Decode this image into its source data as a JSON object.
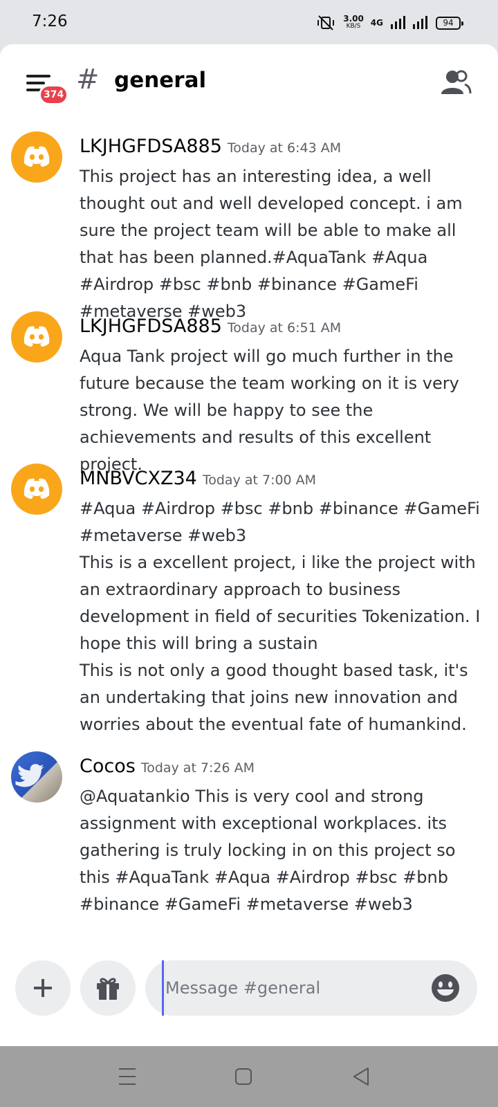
{
  "status_bar": {
    "time": "7:26",
    "speed_value": "3.00",
    "speed_unit": "KB/S",
    "network": "4G",
    "battery": "94"
  },
  "header": {
    "unread_badge": "374",
    "channel_name": "general"
  },
  "messages": [
    {
      "username": "LKJHGFDSA885",
      "timestamp": "Today at 6:43 AM",
      "avatar": "discord-logo-icon",
      "text": "This project has an interesting idea, a well thought out and well developed concept. i am sure the project team will be able to make all that has been planned.#AquaTank #Aqua #Airdrop #bsc #bnb #binance #GameFi #metaverse #web3"
    },
    {
      "username": "LKJHGFDSA885",
      "timestamp": "Today at 6:51 AM",
      "avatar": "discord-logo-icon",
      "text": "Aqua Tank project will go much further in the future because the team working on it is very strong. We will be happy to see the achievements and results of this excellent project."
    },
    {
      "username": "MNBVCXZ34",
      "timestamp": "Today at 7:00 AM",
      "avatar": "discord-logo-icon",
      "text": "#Aqua #Airdrop #bsc #bnb #binance #GameFi #metaverse #web3\nThis is a excellent project, i like the project with an extraordinary approach to business development in field of securities Tokenization. I hope this will bring a sustain\nThis is not only a good thought based task, it's an undertaking that joins new innovation and worries about the eventual fate of humankind."
    },
    {
      "username": "Cocos",
      "timestamp": "Today at 7:26 AM",
      "avatar": "photo-avatar",
      "text": "@Aquatankio This is very cool and strong assignment with exceptional workplaces. its gathering is truly locking in on this project so this #AquaTank #Aqua #Airdrop #bsc #bnb #binance #GameFi #metaverse #web3"
    }
  ],
  "composer": {
    "placeholder": "Message #general"
  },
  "colors": {
    "avatar_bg": "#faa61a",
    "badge_bg": "#e8414a",
    "cursor": "#5865f2"
  }
}
